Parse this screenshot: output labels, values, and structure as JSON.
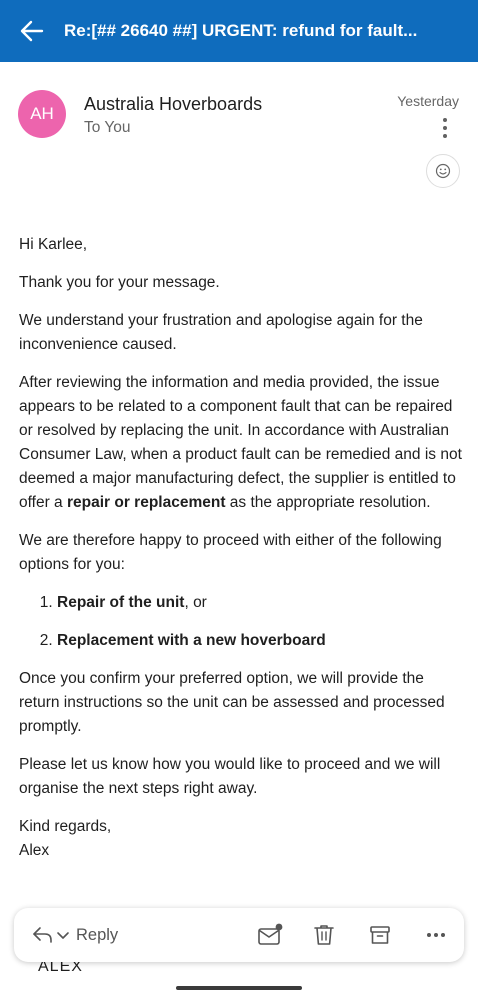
{
  "header": {
    "subject": "Re:[## 26640 ##] URGENT: refund for fault...",
    "back_icon": "arrow-left-icon",
    "accent": "#0f6cbd"
  },
  "message": {
    "avatar_initials": "AH",
    "avatar_color": "#ed64ad",
    "sender": "Australia Hoverboards",
    "recipient": "To You",
    "date": "Yesterday"
  },
  "email": {
    "greeting": "Hi Karlee,",
    "p1": "Thank you for your message.",
    "p2": "We understand your frustration and apologise again for the inconvenience caused.",
    "p3_start": "After reviewing the information and media provided, the issue appears to be related to a component fault that can be repaired or resolved by replacing the unit. In accordance with Australian Consumer Law, when a product fault can be remedied and is not deemed a major manufacturing defect, the supplier is entitled to offer a ",
    "p3_bold": "repair or replacement",
    "p3_end": " as the appropriate resolution.",
    "p4": "We are therefore happy to proceed with either of the following options for you:",
    "option1_bold": "Repair of the unit",
    "option1_rest": ", or",
    "option2_bold": "Replacement with a new hoverboard",
    "p5": "Once you confirm your preferred option, we will provide the return instructions so the unit can be assessed and processed promptly.",
    "p6": "Please let us know how you would like to proceed and we will organise the next steps right away.",
    "signoff": "Kind regards,",
    "signature": "Alex",
    "signature_block": "ALEX"
  },
  "actions": {
    "reply_label": "Reply",
    "icons": [
      "reply-icon",
      "chevron-down-icon",
      "mark-unread-icon",
      "delete-icon",
      "archive-icon",
      "more-icon"
    ]
  }
}
